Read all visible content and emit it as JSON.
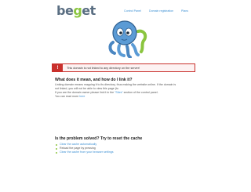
{
  "brand": {
    "logo_left": "be",
    "logo_g": "g",
    "logo_right": "et"
  },
  "nav": {
    "items": [
      "Control Panel",
      "Domain registration",
      "Plans"
    ]
  },
  "alert": {
    "icon": "!",
    "message": "This domain is not linked to any directory on the server!"
  },
  "info": {
    "heading": "What does it mean, and how do I link it?",
    "line1": "Linking domain means mapping it to its directory, thus making the website online. If the domain is",
    "line2": "not linked, you will not be able to view this page (to",
    "line3_before": "If you are the domain owner please link it in the",
    "line3_link": "\"Sites\"",
    "line3_after": "section of the control panel.",
    "line4_before": "You can read more",
    "line4_link": "here"
  },
  "cache": {
    "heading": "Is the problem solved? Try to reset the cache",
    "items": [
      "Clear the cache automatically",
      "Reload the page by pressing",
      "Clear the cache from your browser settings"
    ]
  },
  "colors": {
    "accent_green": "#8bc53f",
    "link_blue": "#3b8fd3",
    "alert_red": "#c9302c",
    "octopus_blue": "#5b9bd5"
  }
}
